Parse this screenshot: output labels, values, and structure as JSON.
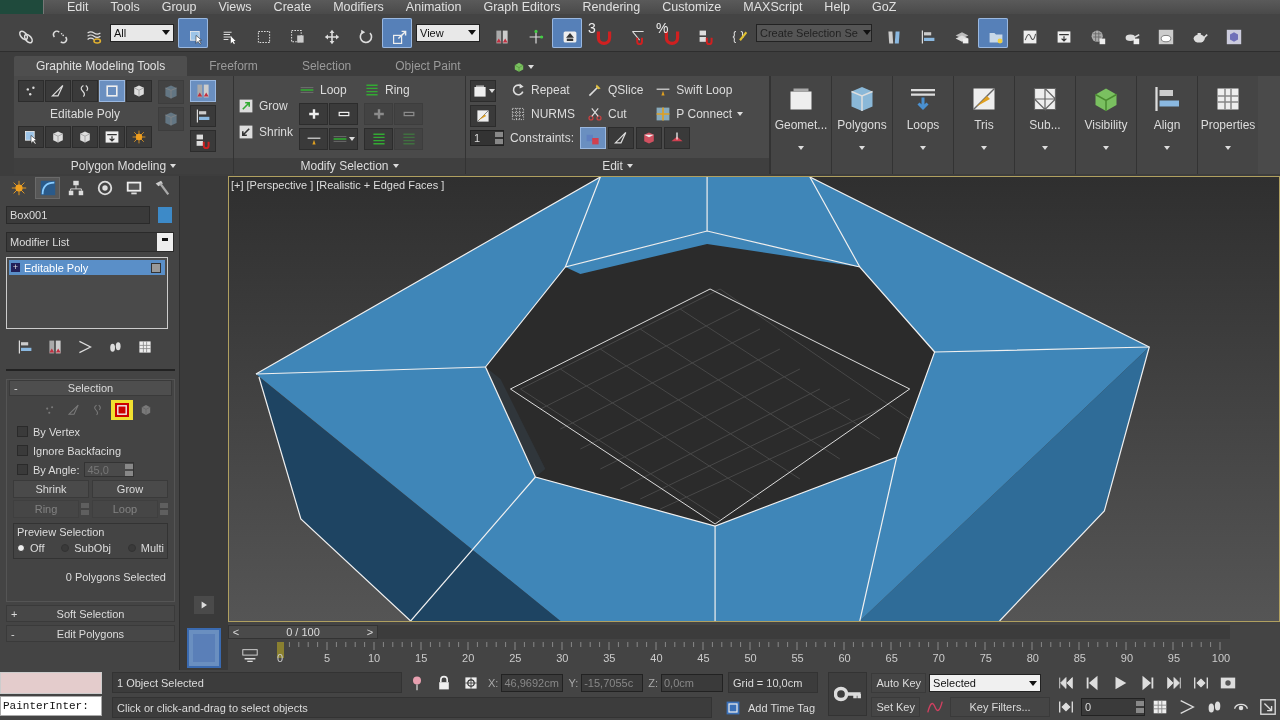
{
  "menu_bar": {
    "items": [
      "Edit",
      "Tools",
      "Group",
      "Views",
      "Create",
      "Modifiers",
      "Animation",
      "Graph Editors",
      "Rendering",
      "Customize",
      "MAXScript",
      "Help",
      "GoZ"
    ]
  },
  "main_toolbar": {
    "tools": [
      {
        "kind": "link",
        "selected": false
      },
      {
        "kind": "unlink",
        "selected": false
      },
      {
        "kind": "bind",
        "selected": false
      },
      {
        "kind": "dropdown",
        "value": "All"
      },
      {
        "kind": "select",
        "selected": true
      },
      {
        "kind": "select-list",
        "selected": false
      },
      {
        "kind": "region",
        "selected": false
      },
      {
        "kind": "window",
        "selected": false
      },
      {
        "kind": "move",
        "selected": false
      },
      {
        "kind": "rotate",
        "selected": false
      },
      {
        "kind": "scale",
        "selected": true
      },
      {
        "kind": "dropdown",
        "value": "View"
      },
      {
        "kind": "pivot",
        "selected": false
      },
      {
        "kind": "manipulate",
        "selected": false
      },
      {
        "kind": "keyboard",
        "selected": true
      },
      {
        "kind": "snap",
        "label": "3",
        "selected": false
      },
      {
        "kind": "angle-snap",
        "selected": false
      },
      {
        "kind": "percent-snap",
        "label": "%",
        "selected": false
      },
      {
        "kind": "spinner-snap",
        "selected": false
      },
      {
        "kind": "named-sets",
        "selected": false
      },
      {
        "kind": "selection-set",
        "placeholder": "Create Selection Se"
      },
      {
        "kind": "mirror",
        "selected": false
      },
      {
        "kind": "align",
        "selected": false
      },
      {
        "kind": "layers",
        "selected": false
      },
      {
        "kind": "ribbon-toggle",
        "selected": true
      },
      {
        "kind": "curve-editor",
        "selected": false
      },
      {
        "kind": "schematic",
        "selected": false
      },
      {
        "kind": "material",
        "selected": false
      },
      {
        "kind": "render-setup",
        "selected": false
      },
      {
        "kind": "rendered-frame",
        "selected": false
      },
      {
        "kind": "render",
        "selected": false
      },
      {
        "kind": "maxscript",
        "selected": false
      }
    ]
  },
  "ribbon": {
    "tabs": [
      {
        "label": "Graphite Modeling Tools",
        "selected": true
      },
      {
        "label": "Freeform",
        "selected": false
      },
      {
        "label": "Selection",
        "selected": false
      },
      {
        "label": "Object Paint",
        "selected": false
      }
    ],
    "polygon_modeling": {
      "levels": [
        {
          "kind": "vertex",
          "selected": false
        },
        {
          "kind": "edge",
          "selected": false
        },
        {
          "kind": "border",
          "selected": false
        },
        {
          "kind": "polygon",
          "selected": true
        },
        {
          "kind": "element",
          "selected": false
        }
      ],
      "object_type": "Editable Poly",
      "footer": "Polygon Modeling"
    },
    "modify_selection": {
      "grow": "Grow",
      "shrink": "Shrink",
      "loop": "Loop",
      "ring": "Ring",
      "footer": "Modify Selection"
    },
    "edit": {
      "buttons": [
        {
          "kind": "repeat",
          "label": "Repeat"
        },
        {
          "kind": "qslice",
          "label": "QSlice"
        },
        {
          "kind": "swift-loop",
          "label": "Swift Loop"
        },
        {
          "kind": "nurms",
          "label": "NURMS"
        },
        {
          "kind": "cut",
          "label": "Cut"
        },
        {
          "kind": "p-connect",
          "label": "P Connect"
        }
      ],
      "spinner": "1",
      "constraints_label": "Constraints:",
      "constraints": [
        {
          "kind": "none",
          "selected": true
        },
        {
          "kind": "edge",
          "selected": false
        },
        {
          "kind": "face",
          "selected": false
        },
        {
          "kind": "normal",
          "selected": false
        }
      ],
      "footer": "Edit"
    },
    "big_buttons": [
      {
        "kind": "geometry",
        "label": "Geomet..."
      },
      {
        "kind": "polygons",
        "label": "Polygons"
      },
      {
        "kind": "loops",
        "label": "Loops"
      },
      {
        "kind": "tris",
        "label": "Tris"
      },
      {
        "kind": "subdivision",
        "label": "Sub..."
      },
      {
        "kind": "visibility",
        "label": "Visibility"
      },
      {
        "kind": "align",
        "label": "Align"
      },
      {
        "kind": "properties",
        "label": "Properties"
      }
    ]
  },
  "command_panel": {
    "tabs": [
      {
        "kind": "create",
        "selected": false
      },
      {
        "kind": "modify",
        "selected": true
      },
      {
        "kind": "hierarchy",
        "selected": false
      },
      {
        "kind": "motion",
        "selected": false
      },
      {
        "kind": "display",
        "selected": false
      },
      {
        "kind": "utilities",
        "selected": false
      }
    ],
    "object_name": "Box001",
    "object_swatch": {
      "color": "#3d8ac8"
    },
    "modifier_list": "Modifier List",
    "stack": [
      {
        "sign": "+",
        "label": "Editable Poly",
        "selected": true
      }
    ],
    "selection_rollout": {
      "sign": "-",
      "title": "Selection",
      "levels": [
        {
          "kind": "vertex",
          "selected": false
        },
        {
          "kind": "edge",
          "selected": false
        },
        {
          "kind": "border",
          "selected": false
        },
        {
          "kind": "polygon",
          "selected": true
        },
        {
          "kind": "element",
          "selected": false
        }
      ],
      "checkboxes": [
        {
          "label": "By Vertex",
          "checked": false
        },
        {
          "label": "Ignore Backfacing",
          "checked": false
        },
        {
          "label": "By Angle:",
          "checked": false
        }
      ],
      "angle": "45,0",
      "shrink": "Shrink",
      "grow": "Grow",
      "ring": "Ring",
      "loop": "Loop",
      "preview": {
        "title": "Preview Selection",
        "options": [
          {
            "label": "Off",
            "selected": true
          },
          {
            "label": "SubObj",
            "selected": false
          },
          {
            "label": "Multi",
            "selected": false
          }
        ]
      },
      "status": "0 Polygons Selected"
    },
    "rollouts": [
      {
        "sign": "+",
        "title": "Soft Selection"
      },
      {
        "sign": "-",
        "title": "Edit Polygons"
      }
    ]
  },
  "viewport": {
    "labels": [
      "[+]",
      "[Perspective ]",
      "[Realistic + Edged Faces ]"
    ],
    "active": true
  },
  "time_slider": {
    "prev": "<",
    "label": "0 / 100",
    "next": ">"
  },
  "track_bar": {
    "ticks": [
      "0",
      "5",
      "10",
      "15",
      "20",
      "25",
      "30",
      "35",
      "40",
      "45",
      "50",
      "55",
      "60",
      "65",
      "70",
      "75",
      "80",
      "85",
      "90",
      "95",
      "100"
    ]
  },
  "status_bar": {
    "listener": "PainterInter:",
    "selection": "1 Object Selected",
    "prompt": "Click or click-and-drag to select objects",
    "x_label": "X:",
    "x": "46,9692cm",
    "y_label": "Y:",
    "y": "-15,7055c",
    "z_label": "Z:",
    "z": "0,0cm",
    "grid": "Grid = 10,0cm",
    "add_time_tag": "Add Time Tag",
    "auto_key": "Auto Key",
    "key_mode": "Selected",
    "set_key": "Set Key",
    "key_filters": "Key Filters...",
    "frame": "0"
  }
}
